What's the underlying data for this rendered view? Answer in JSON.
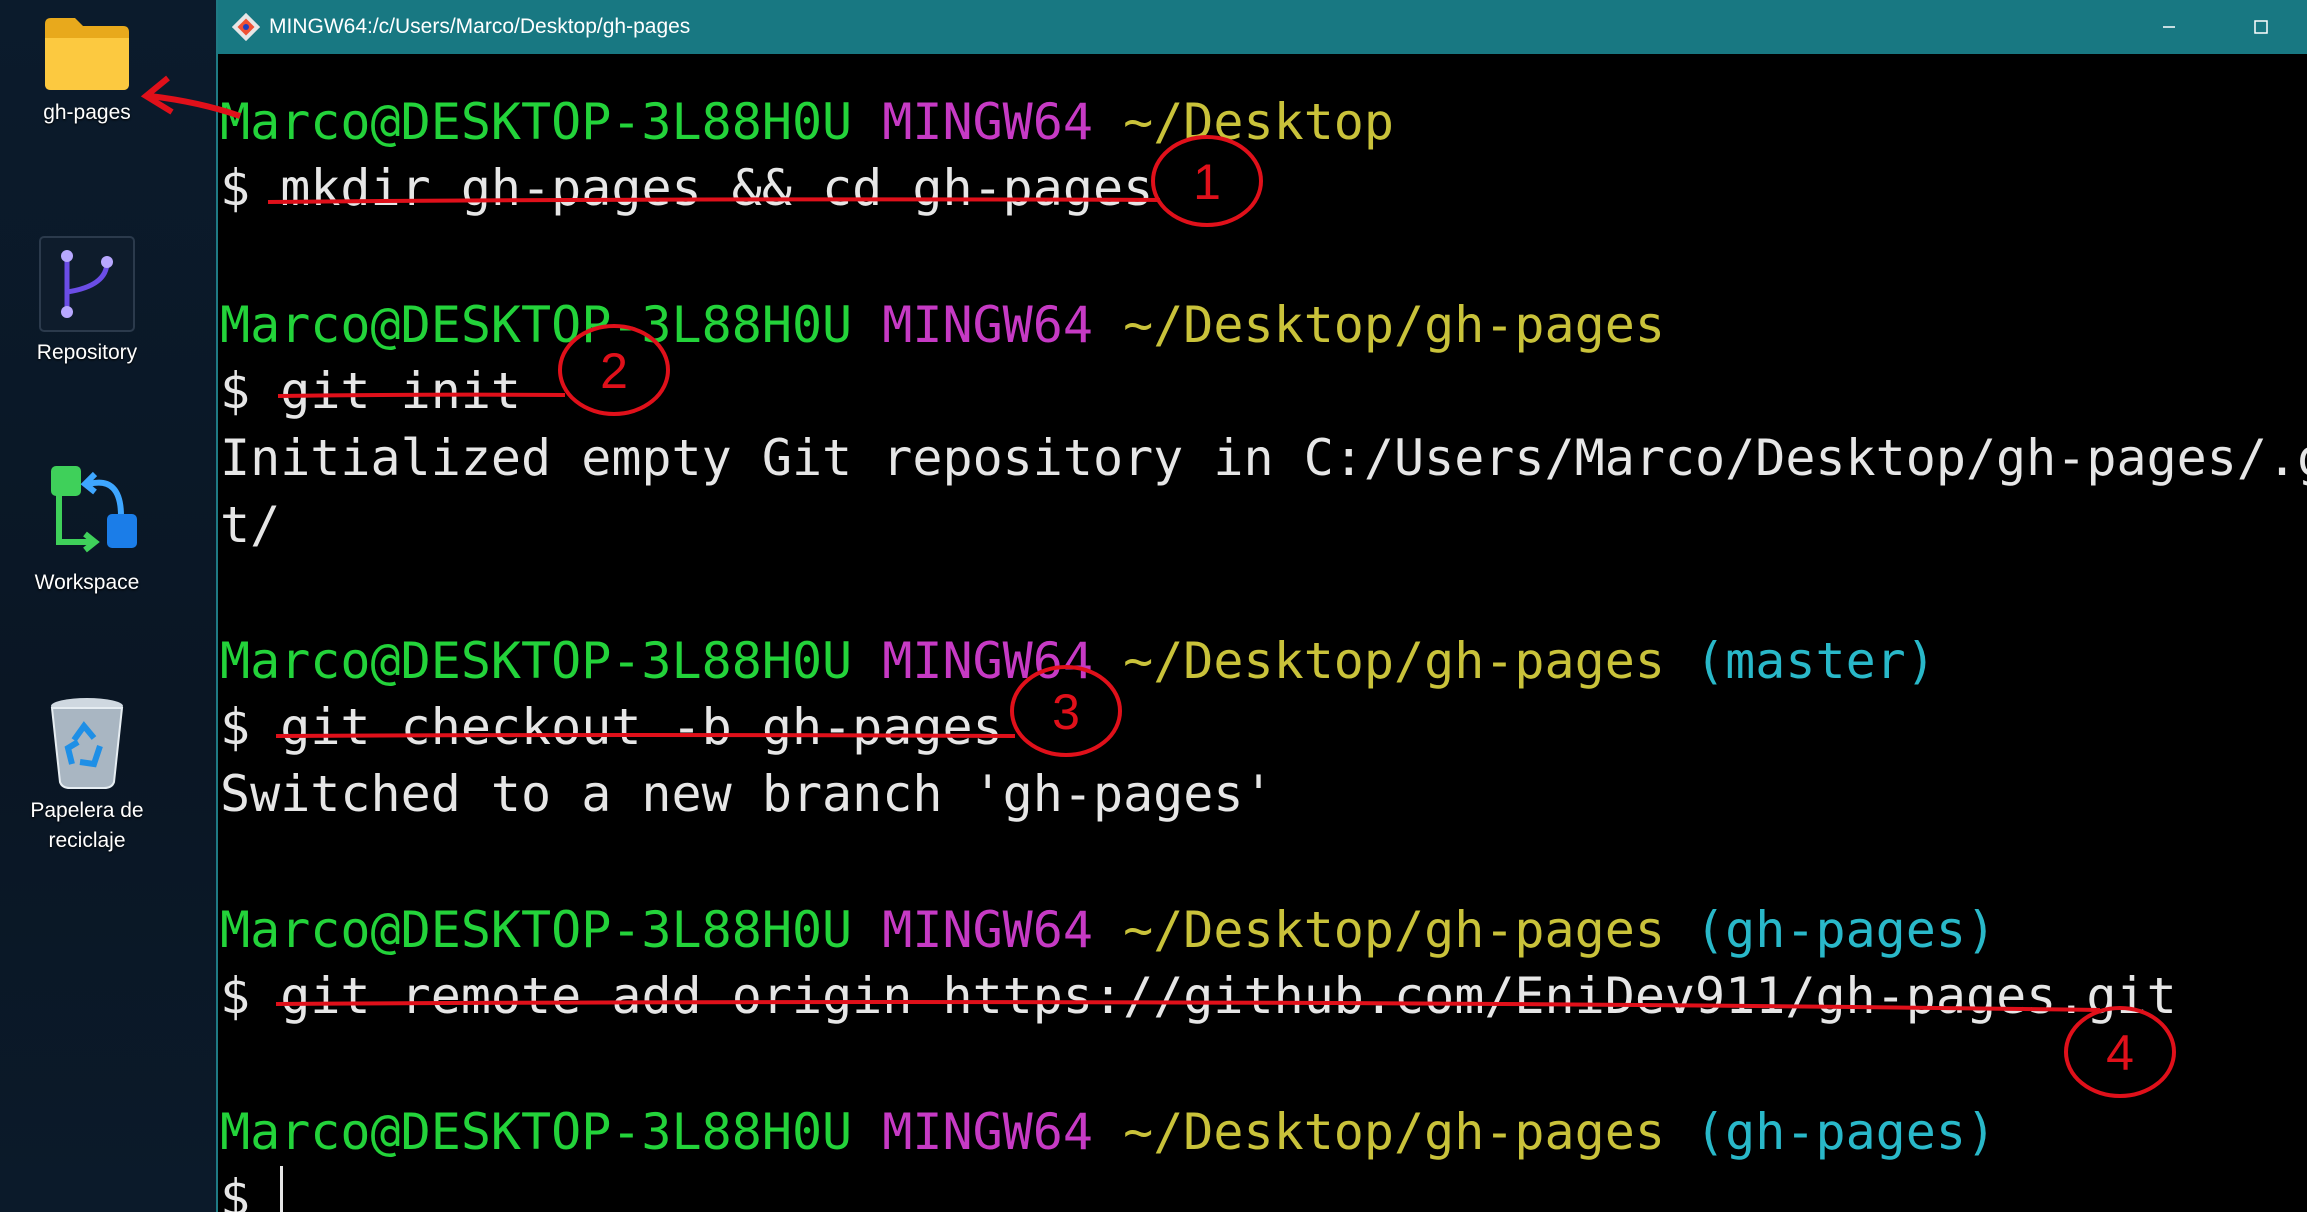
{
  "desktop": {
    "icons": [
      {
        "label": "gh-pages",
        "icon": "folder-icon"
      },
      {
        "label": "Repository",
        "icon": "git-branch-icon"
      },
      {
        "label": "Workspace",
        "icon": "workflow-icon"
      },
      {
        "label": "Papelera de reciclaje",
        "icon": "recycle-bin-icon"
      }
    ]
  },
  "window": {
    "title": "MINGW64:/c/Users/Marco/Desktop/gh-pages",
    "icon": "git-bash-icon"
  },
  "terminal": {
    "prompt_user": "Marco@DESKTOP-3L88H0U",
    "prompt_host": "MINGW64",
    "dollar": "$",
    "blocks": [
      {
        "path": "~/Desktop",
        "branch": "",
        "command": "mkdir gh-pages && cd gh-pages",
        "output": []
      },
      {
        "path": "~/Desktop/gh-pages",
        "branch": "",
        "command": "git init",
        "output": [
          "Initialized empty Git repository in C:/Users/Marco/Desktop/gh-pages/.g",
          "t/"
        ]
      },
      {
        "path": "~/Desktop/gh-pages",
        "branch": "(master)",
        "command": "git checkout -b gh-pages",
        "output": [
          "Switched to a new branch 'gh-pages'"
        ]
      },
      {
        "path": "~/Desktop/gh-pages",
        "branch": "(gh-pages)",
        "command": "git remote add origin https://github.com/EniDev911/gh-pages.git",
        "output": []
      },
      {
        "path": "~/Desktop/gh-pages",
        "branch": "(gh-pages)",
        "command": "",
        "output": []
      }
    ]
  },
  "annotations": {
    "step_labels": [
      "1",
      "2",
      "3",
      "4"
    ],
    "color": "#e0101a"
  }
}
